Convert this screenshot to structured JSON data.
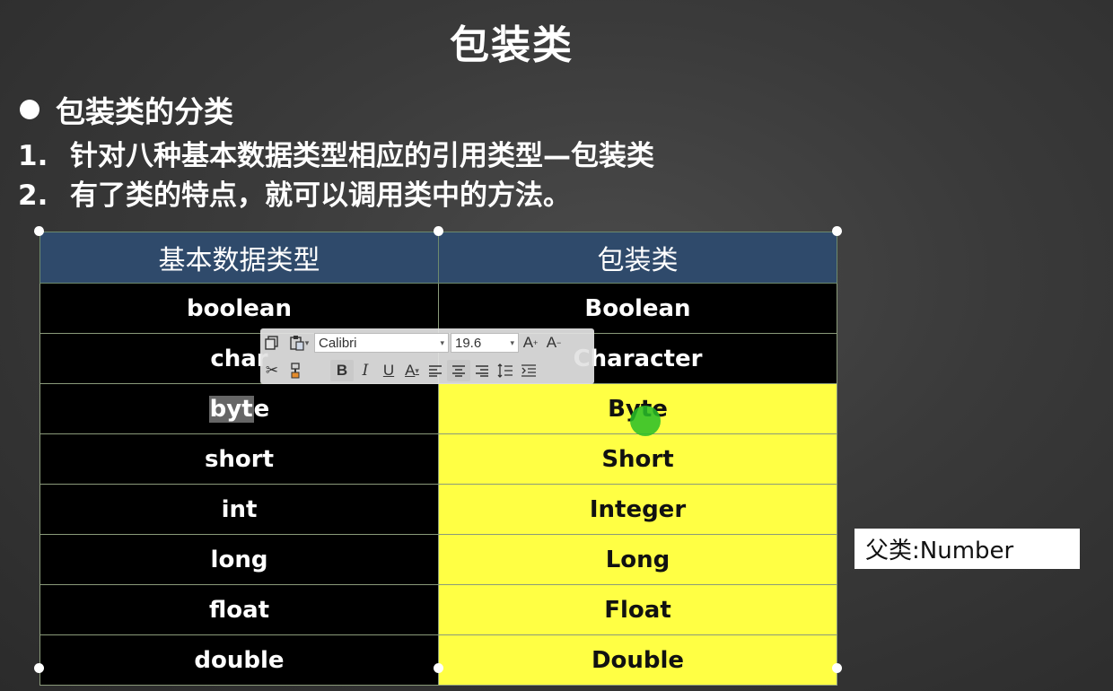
{
  "slide": {
    "title": "包装类",
    "bullet": "包装类的分类",
    "points": [
      {
        "num": "1.",
        "text": "针对八种基本数据类型相应的引用类型—包装类"
      },
      {
        "num": "2.",
        "text": "有了类的特点，就可以调用类中的方法。"
      }
    ]
  },
  "table": {
    "headers": [
      "基本数据类型",
      "包装类"
    ],
    "rows": [
      {
        "primitive": "boolean",
        "wrapper": "Boolean"
      },
      {
        "primitive": "char",
        "wrapper": "Character"
      },
      {
        "primitive": "byte",
        "wrapper": "Byte"
      },
      {
        "primitive": "short",
        "wrapper": "Short"
      },
      {
        "primitive": "int",
        "wrapper": "Integer"
      },
      {
        "primitive": "long",
        "wrapper": "Long"
      },
      {
        "primitive": "float",
        "wrapper": "Float"
      },
      {
        "primitive": "double",
        "wrapper": "Double"
      }
    ],
    "selected_text": "byt",
    "selected_rest": "e",
    "colors": {
      "header_bg": "#2f4a6b",
      "dark_cell": "#000000",
      "highlight": "#ffff44"
    }
  },
  "toolbar": {
    "font_name": "Calibri",
    "font_size": "19.6",
    "icons": [
      "copy-icon",
      "paste-icon",
      "font-grow-icon",
      "font-shrink-icon",
      "cut-icon",
      "format-painter-icon",
      "bold-icon",
      "italic-icon",
      "underline-icon",
      "font-color-icon",
      "align-left-icon",
      "align-center-icon",
      "align-right-icon",
      "line-spacing-icon",
      "indent-icon"
    ]
  },
  "note": {
    "text": "父类:Number"
  }
}
